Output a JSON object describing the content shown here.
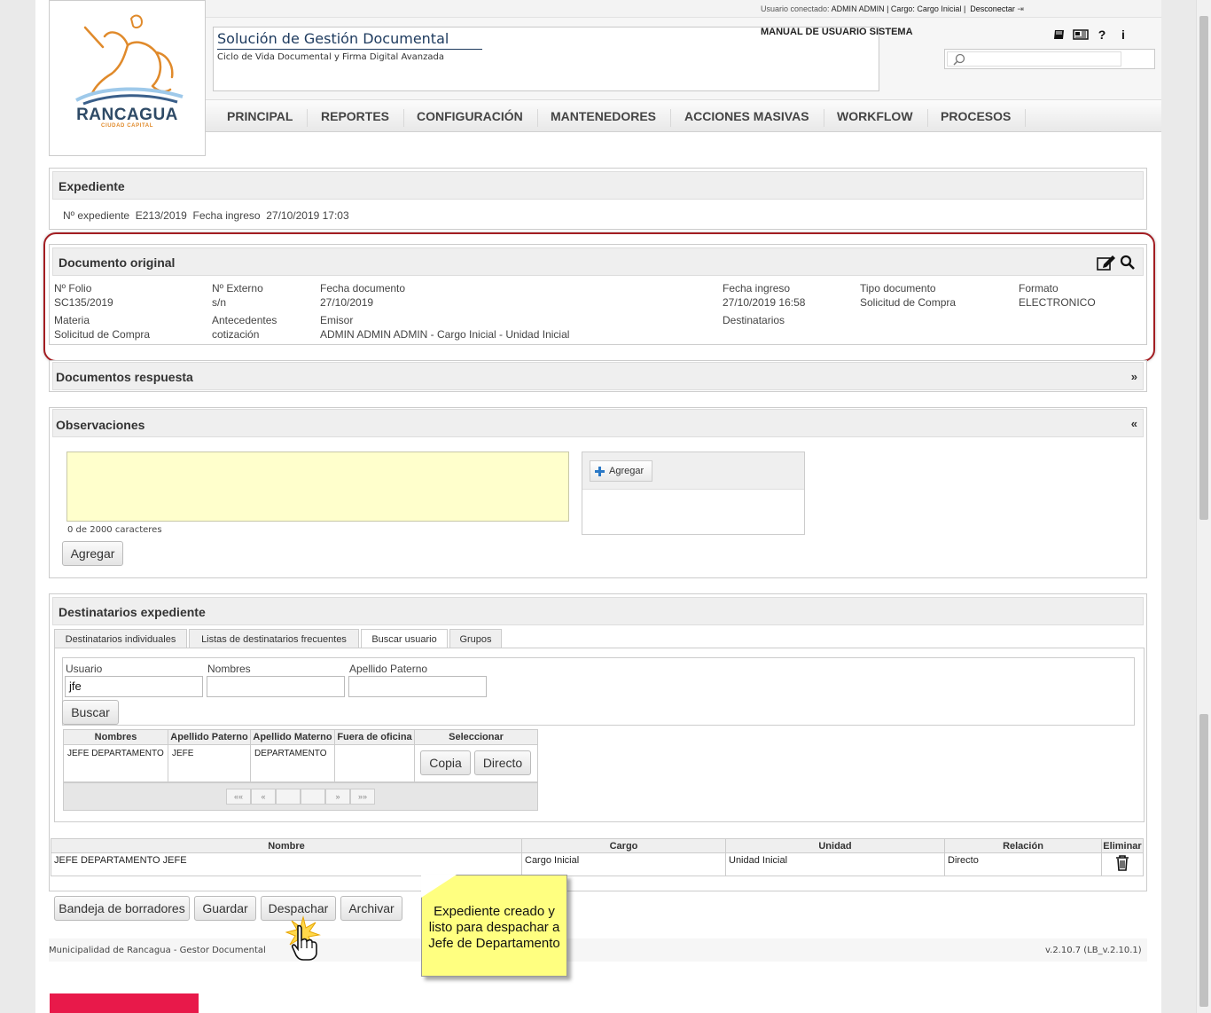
{
  "header": {
    "user_info_prefix": "Usuario conectado:",
    "user_info_value": "ADMIN ADMIN | Cargo: Cargo Inicial |",
    "logout_label": "Desconectar",
    "logo_text": "RANCAGUA",
    "logo_sub": "CIUDAD CAPITAL",
    "app_title": "Solución de Gestión Documental",
    "app_subtitle": "Ciclo de Vida Documental y Firma Digital Avanzada",
    "manual_label": "MANUAL DE USUARIO SISTEMA",
    "icons": [
      "book-icon",
      "news-icon",
      "help-icon",
      "info-icon"
    ]
  },
  "nav": {
    "items": [
      "PRINCIPAL",
      "REPORTES",
      "CONFIGURACIÓN",
      "MANTENEDORES",
      "ACCIONES MASIVAS",
      "WORKFLOW",
      "PROCESOS"
    ]
  },
  "expediente": {
    "title": "Expediente",
    "num_label": "Nº expediente",
    "num_value": "E213/2019",
    "fecha_label": "Fecha ingreso",
    "fecha_value": "27/10/2019 17:03"
  },
  "documento": {
    "title": "Documento original",
    "folio_label": "Nº Folio",
    "folio_value": "SC135/2019",
    "externo_label": "Nº Externo",
    "externo_value": "s/n",
    "fecha_doc_label": "Fecha documento",
    "fecha_doc_value": "27/10/2019",
    "fecha_ing_label": "Fecha ingreso",
    "fecha_ing_value": "27/10/2019 16:58",
    "tipo_label": "Tipo documento",
    "tipo_value": "Solicitud de Compra",
    "formato_label": "Formato",
    "formato_value": "ELECTRONICO",
    "materia_label": "Materia",
    "materia_value": "Solicitud de Compra",
    "antecedentes_label": "Antecedentes",
    "antecedentes_value": "cotización",
    "emisor_label": "Emisor",
    "emisor_value": "ADMIN ADMIN ADMIN - Cargo Inicial - Unidad Inicial",
    "destinatarios_label": "Destinatarios"
  },
  "respuesta": {
    "title": "Documentos respuesta",
    "chevron": "»"
  },
  "observaciones": {
    "title": "Observaciones",
    "chevron": "«",
    "counter": "0 de 2000 caracteres",
    "add_button": "Agregar",
    "side_add_button": "Agregar"
  },
  "destinatarios": {
    "title": "Destinatarios expediente",
    "tabs": [
      "Destinatarios individuales",
      "Listas de destinatarios frecuentes",
      "Buscar usuario",
      "Grupos"
    ],
    "active_tab": "Buscar usuario",
    "usuario_label": "Usuario",
    "usuario_value": "jfe",
    "nombres_label": "Nombres",
    "apellido_label": "Apellido Paterno",
    "search_button": "Buscar",
    "results_headers": [
      "Nombres",
      "Apellido Paterno",
      "Apellido Materno",
      "Fuera de oficina",
      "Seleccionar"
    ],
    "results_rows": [
      {
        "nombres": "JEFE DEPARTAMENTO",
        "ap_paterno": "JEFE",
        "ap_materno": "DEPARTAMENTO",
        "fuera": ""
      }
    ],
    "copy_button": "Copia",
    "direct_button": "Directo",
    "pager": [
      "««",
      "«",
      "",
      "",
      "»",
      "»»"
    ],
    "dest_headers": [
      "Nombre",
      "Cargo",
      "Unidad",
      "Relación",
      "Eliminar"
    ],
    "dest_rows": [
      {
        "nombre": "JEFE DEPARTAMENTO JEFE",
        "cargo": "Cargo Inicial",
        "unidad": "Unidad Inicial",
        "relacion": "Directo"
      }
    ]
  },
  "actions": {
    "borradores": "Bandeja de borradores",
    "guardar": "Guardar",
    "despachar": "Despachar",
    "archivar": "Archivar"
  },
  "footer": {
    "left": "Municipalidad de Rancagua - Gestor Documental",
    "right": "v.2.10.7 (LB_v.2.10.1)"
  },
  "callout": {
    "text": "Expediente creado y listo para despachar a Jefe de Departamento"
  },
  "colors": {
    "highlight_frame": "#a21d22",
    "callout_bg": "#ffff80",
    "textarea_bg": "#ffffcc",
    "brand_red": "#e8194a"
  }
}
